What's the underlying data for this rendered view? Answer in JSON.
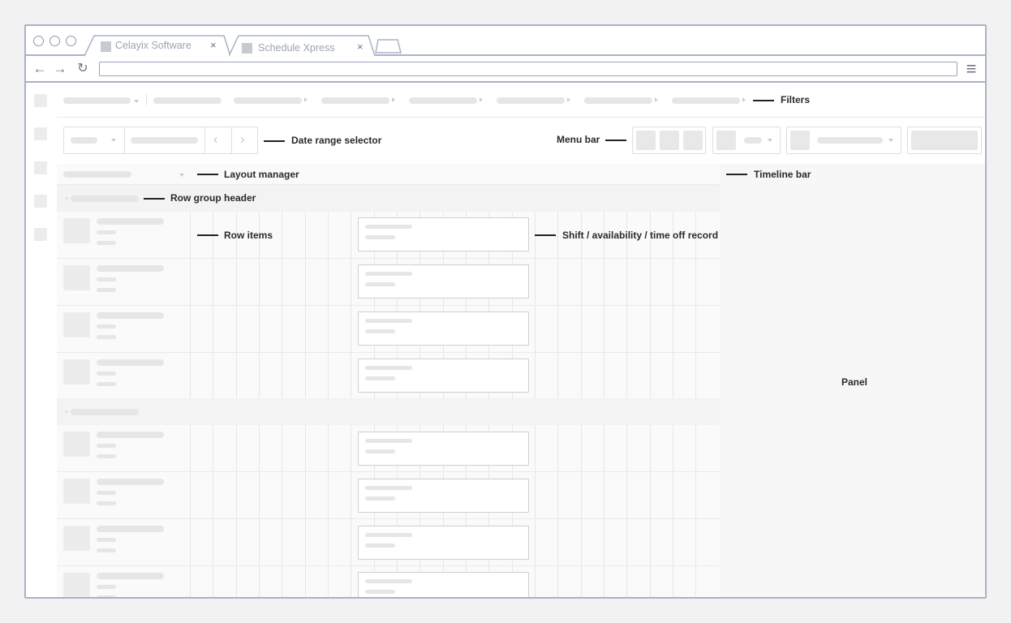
{
  "browser": {
    "tabs": [
      {
        "title": "Celayix Software",
        "close": "×"
      },
      {
        "title": "Schedule Xpress",
        "close": "×"
      }
    ],
    "nav": {
      "back": "←",
      "forward": "→",
      "reload": "↻",
      "menu": "≡"
    },
    "url": ""
  },
  "callouts": {
    "filters": "Filters",
    "date_range_selector": "Date range selector",
    "menu_bar": "Menu bar",
    "layout_manager": "Layout manager",
    "timeline_bar": "Timeline bar",
    "row_group_header": "Row group header",
    "row_items": "Row items",
    "shift_record": "Shift / availability / time off record",
    "panel": "Panel"
  },
  "toolbar": {
    "prev": "‹",
    "next": "›"
  },
  "colors": {
    "frame": "#a8b2c8",
    "placeholder": "#e6e6e6",
    "panel": "#f7f7f7",
    "callout": "#222222"
  }
}
